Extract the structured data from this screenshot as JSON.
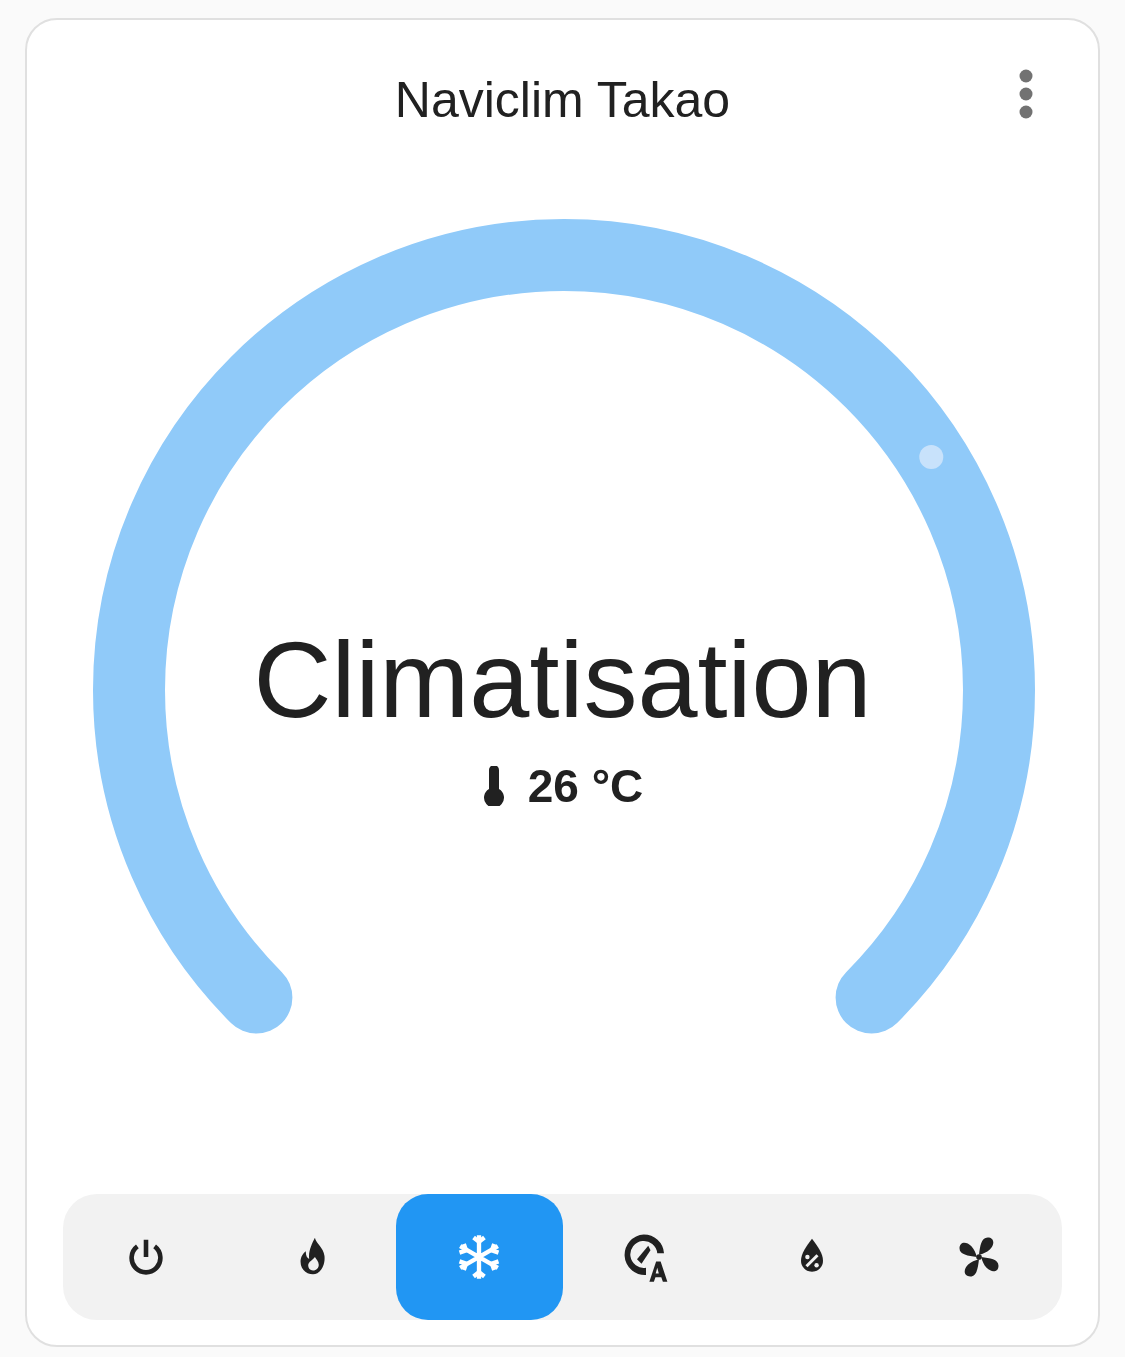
{
  "card": {
    "title": "Naviclim Takao"
  },
  "gauge": {
    "mode_label": "Climatisation",
    "current_temperature": "26 °C"
  },
  "modes": [
    {
      "kind": "off",
      "selected": false
    },
    {
      "kind": "heat",
      "selected": false
    },
    {
      "kind": "cool",
      "selected": true
    },
    {
      "kind": "auto",
      "selected": false
    },
    {
      "kind": "dry",
      "selected": false
    },
    {
      "kind": "fan",
      "selected": false
    }
  ]
}
